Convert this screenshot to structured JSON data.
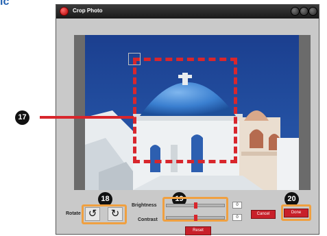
{
  "header": {
    "cropped_text": "ic"
  },
  "window": {
    "title": "Crop Photo"
  },
  "callouts": {
    "c17": "17",
    "c18": "18",
    "c19": "19",
    "c20": "20"
  },
  "controls": {
    "rotate_label": "Rotate",
    "rotate_left_symbol": "↺",
    "rotate_right_symbol": "↻",
    "brightness_label": "Brightness",
    "contrast_label": "Contrast",
    "brightness_value": "0",
    "contrast_value": "0",
    "reset_label": "Reset",
    "cancel_label": "Cancel",
    "done_label": "Done",
    "brightness_level": 0.5,
    "contrast_level": 0.5
  },
  "colors": {
    "crop_box": "#d8262c",
    "highlight": "#f0a040",
    "title_bar": "#2a2a2a"
  }
}
